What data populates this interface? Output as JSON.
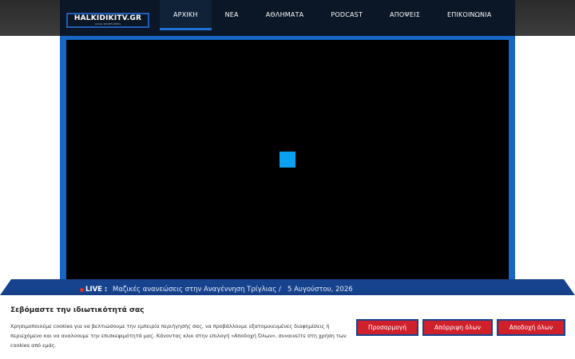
{
  "header": {
    "logo_text": "HALKIDIKITV.GR",
    "logo_tagline": "LOCAL SPORTS NEWS",
    "nav": [
      {
        "label": "ΑΡΧΙΚΗ",
        "active": true
      },
      {
        "label": "ΝΕΑ"
      },
      {
        "label": "ΑΘΛΗΜΑΤΑ"
      },
      {
        "label": "PODCAST"
      },
      {
        "label": "ΑΠΟΨΕΙΣ"
      },
      {
        "label": "ΕΠΙΚΟΙΝΩΝΙΑ"
      }
    ]
  },
  "video": {
    "spinner_color": "#0aa2f0"
  },
  "live": {
    "label": "LIVE :",
    "headline": "Μαζικές ανανεώσεις στην Αναγέννηση Τρίγλιας",
    "separator": "/",
    "date": "5 Αυγούστου, 2026"
  },
  "cookie": {
    "title": "Σεβόμαστε την ιδιωτικότητά σας",
    "text": "Χρησιμοποιούμε cookies για να βελτιώσουμε την εμπειρία περιήγησής σας, να προβάλλουμε εξατομικευμένες διαφημίσεις ή περιεχόμενο και να αναλύουμε την επισκεψιμότητά μας. Κάνοντας κλικ στην επιλογή «Αποδοχή Όλων», συναινείτε στη χρήση των cookies από εμάς.",
    "buttons": {
      "customize": "Προσαρμογή",
      "reject": "Απόρριψη όλων",
      "accept": "Αποδοχή όλων"
    }
  },
  "colors": {
    "brand_blue": "#1766c4",
    "button_red": "#d0202b",
    "header_dark": "#0b1626"
  }
}
